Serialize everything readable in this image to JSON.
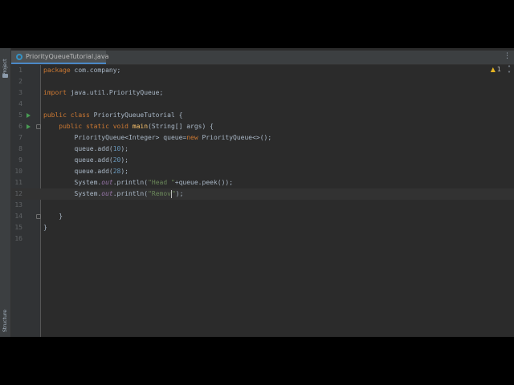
{
  "tool_windows": {
    "left_top": "Project",
    "left_bottom": "Structure"
  },
  "editor_tab": {
    "filename": "PriorityQueueTutorial.java"
  },
  "inspections": {
    "warning_count": "1"
  },
  "code_lines": [
    {
      "num": "1",
      "code": "package com.company;"
    },
    {
      "num": "2",
      "code": ""
    },
    {
      "num": "3",
      "code": "import java.util.PriorityQueue;"
    },
    {
      "num": "4",
      "code": ""
    },
    {
      "num": "5",
      "code": "public class PriorityQueueTutorial {"
    },
    {
      "num": "6",
      "code": "    public static void main(String[] args) {"
    },
    {
      "num": "7",
      "code": "        PriorityQueue<Integer> queue=new PriorityQueue<>();"
    },
    {
      "num": "8",
      "code": "        queue.add(10);"
    },
    {
      "num": "9",
      "code": "        queue.add(20);"
    },
    {
      "num": "10",
      "code": "        queue.add(28);"
    },
    {
      "num": "11",
      "code": "        System.out.println(\"Head \"+queue.peek());"
    },
    {
      "num": "12",
      "code": "        System.out.println(\"Remov\");"
    },
    {
      "num": "13",
      "code": ""
    },
    {
      "num": "14",
      "code": "    }"
    },
    {
      "num": "15",
      "code": "}"
    },
    {
      "num": "16",
      "code": ""
    }
  ],
  "colors": {
    "keyword": "#cc7832",
    "method_decl": "#ffc66d",
    "number": "#6897bb",
    "string": "#6a8759",
    "static_field": "#9876aa",
    "run_gutter": "#499c54",
    "background": "#2b2b2b"
  }
}
